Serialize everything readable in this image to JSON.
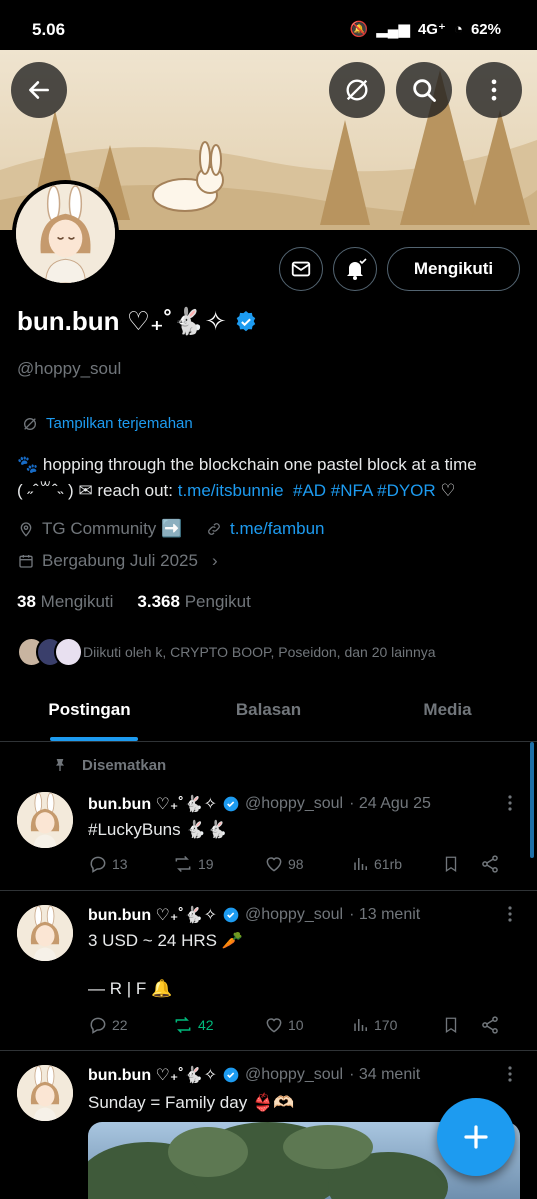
{
  "status": {
    "time": "5.06",
    "network": "4G⁺",
    "battery": "62%"
  },
  "profile": {
    "display_name": "bun.bun ♡₊˚🐇✧",
    "handle": "@hoppy_soul",
    "translate_label": "Tampilkan terjemahan",
    "bio_line1": "🐾 hopping through the blockchain one pastel block at a time",
    "bio_line2_prefix": "( ˶ˆ꒳ˆ˵ ) ✉ reach out: ",
    "bio_link": "t.me/itsbunnie",
    "bio_tags": "#AD #NFA #DYOR",
    "bio_suffix": " ♡",
    "location": "TG Community ➡️",
    "website": "t.me/fambun",
    "joined": "Bergabung Juli 2025",
    "following_count": "38",
    "following_label": "Mengikuti",
    "followers_count": "3.368",
    "followers_label": "Pengikut",
    "followed_by": "Diikuti oleh k, CRYPTO BOOP, Poseidon, dan 20 lainnya",
    "follow_button": "Mengikuti"
  },
  "tabs": [
    "Postingan",
    "Balasan",
    "Media"
  ],
  "pinned_label": "Disematkan",
  "tweets": [
    {
      "name": "bun.bun ♡₊˚🐇✧",
      "handle": "@hoppy_soul",
      "time": "· 24 Agu 25",
      "body": "#LuckyBuns 🐇🐇",
      "replies": "13",
      "reposts": "19",
      "likes": "98",
      "views": "61rb"
    },
    {
      "name": "bun.bun ♡₊˚🐇✧",
      "handle": "@hoppy_soul",
      "time": "· 13 menit",
      "body_line1": "3 USD ~ 24 HRS 🥕",
      "body_line2": "— R | F 🔔",
      "replies": "22",
      "reposts": "42",
      "likes": "10",
      "views": "170"
    },
    {
      "name": "bun.bun ♡₊˚🐇✧",
      "handle": "@hoppy_soul",
      "time": "· 34 menit",
      "body": "Sunday = Family day 👙🫶🏻"
    }
  ],
  "colors": {
    "accent": "#1d9bf0",
    "repost_active": "#00ba7c",
    "muted": "#71767b"
  }
}
